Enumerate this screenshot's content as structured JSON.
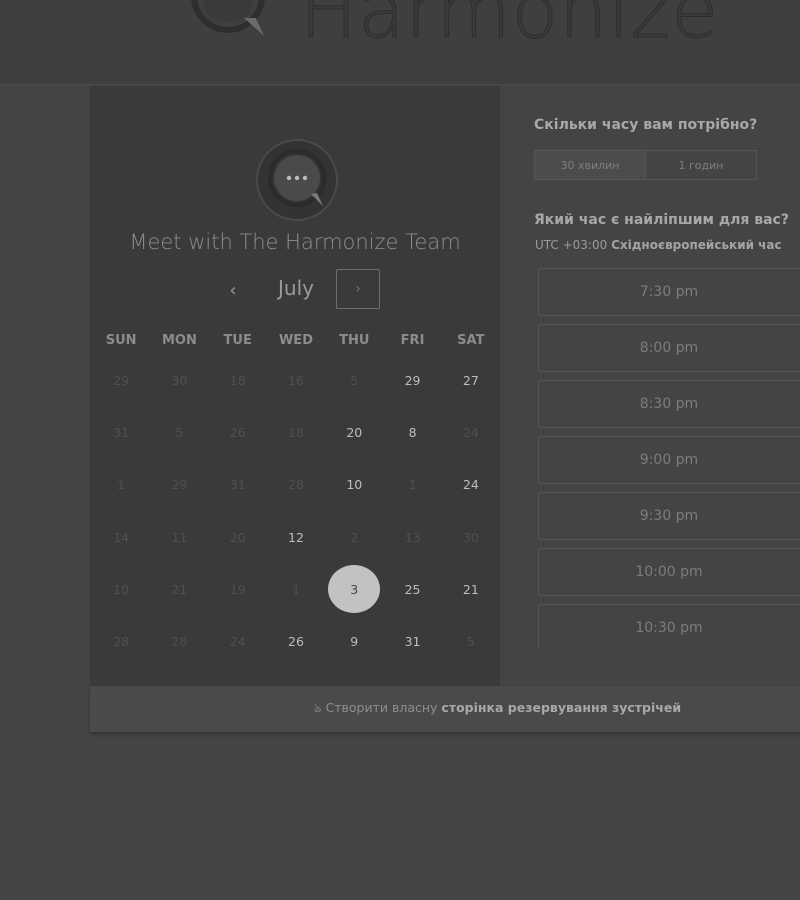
{
  "header": {
    "brand_name": "Harmonize"
  },
  "organizer": {
    "title": "Meet with The Harmonize Team"
  },
  "calendar": {
    "month": "July",
    "prev_symbol": "‹",
    "next_symbol": "›",
    "weekdays": [
      "SUN",
      "MON",
      "TUE",
      "WED",
      "THU",
      "FRI",
      "SAT"
    ],
    "weeks": [
      [
        {
          "d": "29",
          "a": false
        },
        {
          "d": "30",
          "a": false
        },
        {
          "d": "18",
          "a": false
        },
        {
          "d": "16",
          "a": false
        },
        {
          "d": "5",
          "a": false
        },
        {
          "d": "29",
          "a": true
        },
        {
          "d": "27",
          "a": true
        }
      ],
      [
        {
          "d": "31",
          "a": false
        },
        {
          "d": "5",
          "a": false
        },
        {
          "d": "26",
          "a": false
        },
        {
          "d": "18",
          "a": false
        },
        {
          "d": "20",
          "a": true
        },
        {
          "d": "8",
          "a": true
        },
        {
          "d": "24",
          "a": false
        }
      ],
      [
        {
          "d": "1",
          "a": false
        },
        {
          "d": "29",
          "a": false
        },
        {
          "d": "31",
          "a": false
        },
        {
          "d": "28",
          "a": false
        },
        {
          "d": "10",
          "a": true
        },
        {
          "d": "1",
          "a": false
        },
        {
          "d": "24",
          "a": true
        }
      ],
      [
        {
          "d": "14",
          "a": false
        },
        {
          "d": "11",
          "a": false
        },
        {
          "d": "20",
          "a": false
        },
        {
          "d": "12",
          "a": true
        },
        {
          "d": "2",
          "a": false
        },
        {
          "d": "13",
          "a": false
        },
        {
          "d": "30",
          "a": false
        }
      ],
      [
        {
          "d": "10",
          "a": false
        },
        {
          "d": "21",
          "a": false
        },
        {
          "d": "19",
          "a": false
        },
        {
          "d": "1",
          "a": false
        },
        {
          "d": "3",
          "a": true,
          "selected": true
        },
        {
          "d": "25",
          "a": true
        },
        {
          "d": "21",
          "a": true
        }
      ],
      [
        {
          "d": "28",
          "a": false
        },
        {
          "d": "28",
          "a": false
        },
        {
          "d": "24",
          "a": false
        },
        {
          "d": "26",
          "a": true
        },
        {
          "d": "9",
          "a": true
        },
        {
          "d": "31",
          "a": true
        },
        {
          "d": "5",
          "a": false
        }
      ]
    ]
  },
  "duration": {
    "question": "Скільки часу вам потрібно?",
    "options": [
      "30 хвилин",
      "1 годин"
    ],
    "selected_index": 0
  },
  "times": {
    "question": "Який час є найліпшим для вас?",
    "tz_offset": "UTC +03:00",
    "tz_name": "Східноєвропейський час",
    "slots": [
      "7:30 pm",
      "8:00 pm",
      "8:30 pm",
      "9:00 pm",
      "9:30 pm",
      "10:00 pm",
      "10:30 pm"
    ]
  },
  "footer": {
    "icon": "hubspot-sprocket-icon",
    "text_prefix": "Створити власну",
    "text_bold": "сторінка резервування зустрічей"
  }
}
